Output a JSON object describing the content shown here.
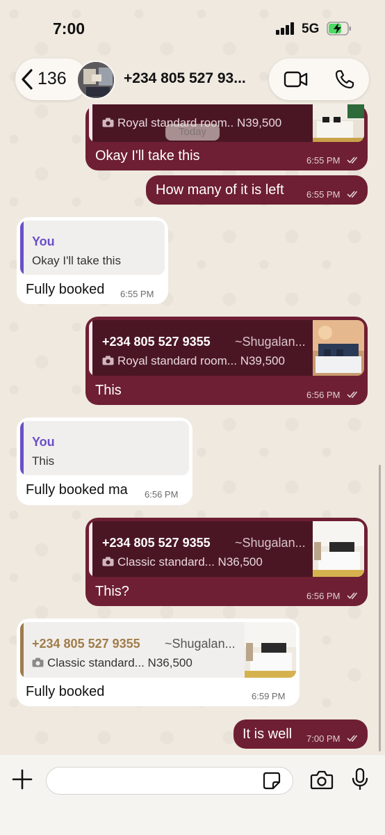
{
  "status_bar": {
    "time": "7:00",
    "network": "5G"
  },
  "header": {
    "back_count": "136",
    "contact_name": "+234 805 527 93..."
  },
  "date_chip": "Today",
  "messages": [
    {
      "direction": "outgoing",
      "quote": {
        "caption": "Royal standard room.. N39,500"
      },
      "text": "Okay I'll take this",
      "time": "6:55 PM"
    },
    {
      "direction": "outgoing",
      "text": "How many of it is left",
      "time": "6:55 PM"
    },
    {
      "direction": "incoming",
      "quote": {
        "sender": "You",
        "text": "Okay I'll take this"
      },
      "text": "Fully booked",
      "time": "6:55 PM"
    },
    {
      "direction": "outgoing",
      "quote": {
        "phone": "+234 805 527 9355",
        "alias": "~Shugalan...",
        "caption": "Royal standard room... N39,500"
      },
      "text": "This",
      "time": "6:56 PM"
    },
    {
      "direction": "incoming",
      "quote": {
        "sender": "You",
        "text": "This"
      },
      "text": "Fully booked ma",
      "time": "6:56 PM"
    },
    {
      "direction": "outgoing",
      "quote": {
        "phone": "+234 805 527 9355",
        "alias": "~Shugalan...",
        "caption": "Classic standard... N36,500"
      },
      "text": "This?",
      "time": "6:56 PM"
    },
    {
      "direction": "incoming",
      "quote": {
        "phone": "+234 805 527 9355",
        "alias": "~Shugalan...",
        "caption": "Classic standard... N36,500"
      },
      "text": "Fully booked",
      "time": "6:59 PM"
    },
    {
      "direction": "outgoing",
      "text": "It is well",
      "time": "7:00 PM"
    }
  ],
  "input": {
    "placeholder": ""
  },
  "colors": {
    "outgoing_bubble": "#6e1f33",
    "incoming_bubble": "#ffffff",
    "quote_you_accent": "#6a4fc9",
    "quote_contact_accent": "#a07c4a"
  },
  "icons": [
    "back-chevron-icon",
    "video-call-icon",
    "phone-call-icon",
    "plus-icon",
    "sticker-icon",
    "camera-icon",
    "microphone-icon",
    "read-ticks-icon",
    "camera-mini-icon"
  ]
}
